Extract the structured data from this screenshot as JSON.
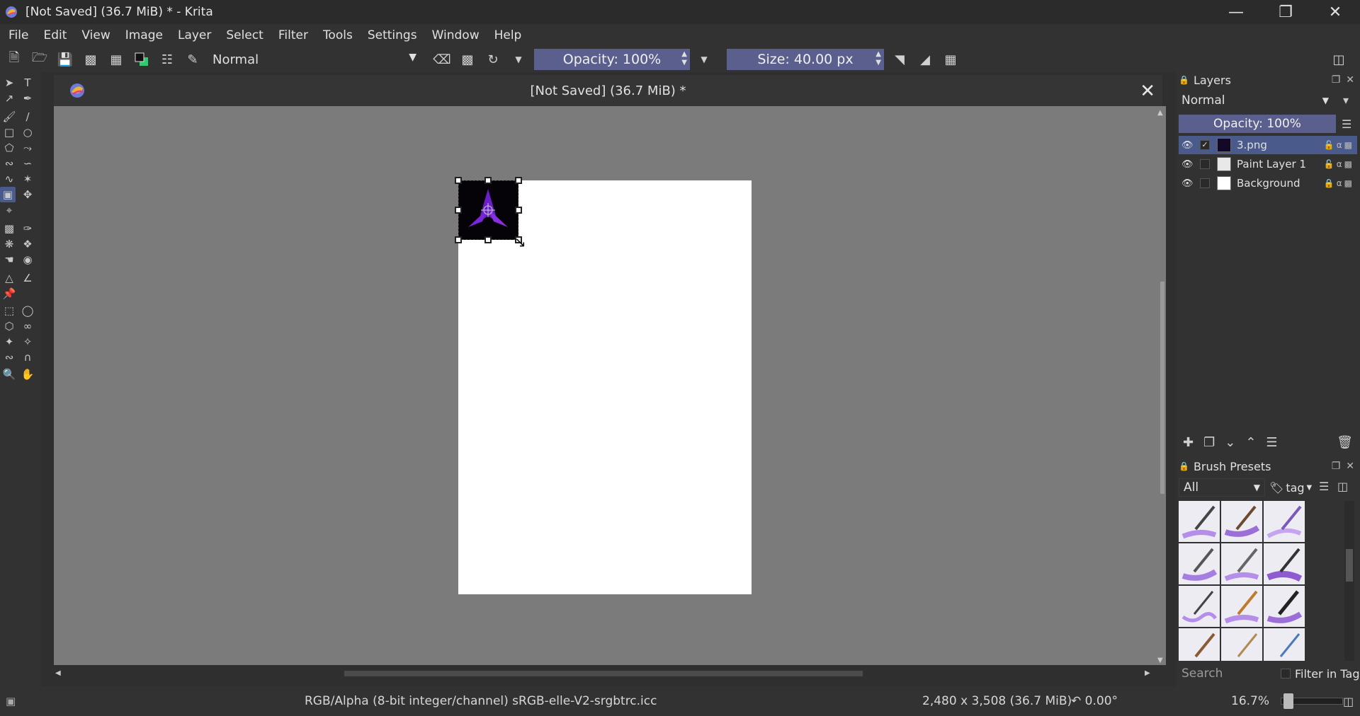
{
  "window": {
    "title": "[Not Saved]  (36.7 MiB) * - Krita",
    "controls": [
      "minimize-icon",
      "restore-icon",
      "close-icon"
    ]
  },
  "menu": [
    "File",
    "Edit",
    "View",
    "Image",
    "Layer",
    "Select",
    "Filter",
    "Tools",
    "Settings",
    "Window",
    "Help"
  ],
  "toolbar": {
    "blend_mode": "Normal",
    "opacity_label": "Opacity: 100%",
    "size_label": "Size: 40.00 px"
  },
  "document": {
    "tab_title": "[Not Saved]  (36.7 MiB) *"
  },
  "layers_panel": {
    "title": "Layers",
    "blend_mode": "Normal",
    "opacity_label": "Opacity:  100%",
    "layers": [
      {
        "name": "3.png",
        "selected": true,
        "checked": true
      },
      {
        "name": "Paint Layer 1",
        "selected": false,
        "checked": false
      },
      {
        "name": "Background",
        "selected": false,
        "checked": false
      }
    ]
  },
  "brush_presets": {
    "title": "Brush Presets",
    "filter": "All",
    "tag_label": "tag",
    "search_placeholder": "Search",
    "filter_in_tag": "Filter in Tag"
  },
  "status": {
    "colorspace": "RGB/Alpha (8-bit integer/channel)  sRGB-elle-V2-srgbtrc.icc",
    "image_size": "2,480 x 3,508 (36.7 MiB)",
    "rotation": "0.00°",
    "zoom": "16.7%"
  },
  "colors": {
    "accent": "#5a5f8e",
    "selection": "#4a5a8a",
    "canvas_bg": "#7b7b7b",
    "logo_purple": "#7b2fd6"
  }
}
